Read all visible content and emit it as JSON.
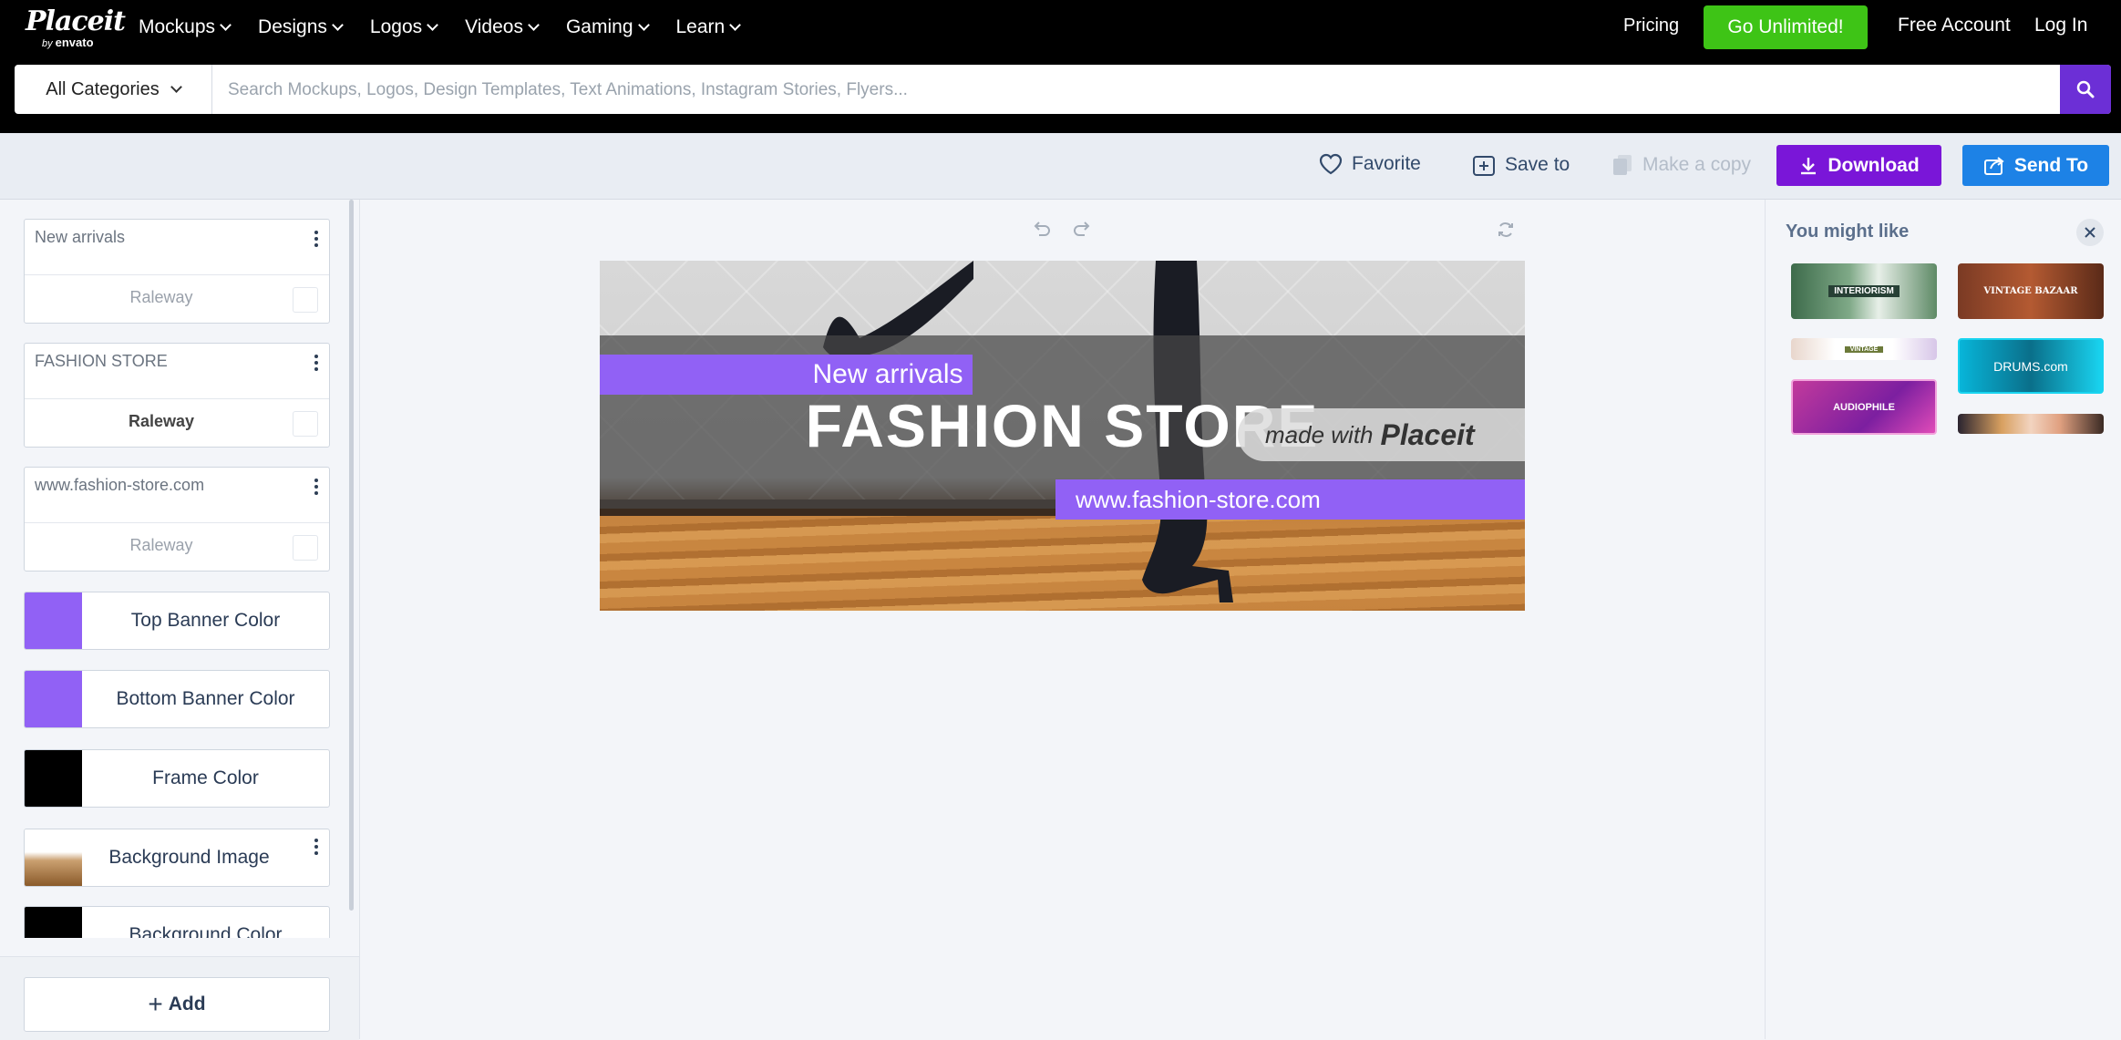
{
  "brand": {
    "logo_text": "Placeit",
    "logo_by": "by",
    "logo_sub": "envato"
  },
  "nav": {
    "items": [
      {
        "label": "Mockups"
      },
      {
        "label": "Designs"
      },
      {
        "label": "Logos"
      },
      {
        "label": "Videos"
      },
      {
        "label": "Gaming"
      },
      {
        "label": "Learn"
      }
    ],
    "pricing": "Pricing",
    "unlimited": "Go Unlimited!",
    "free_account": "Free Account",
    "login": "Log In"
  },
  "search": {
    "category": "All Categories",
    "placeholder": "Search Mockups, Logos, Design Templates, Text Animations, Instagram Stories, Flyers..."
  },
  "toolbar": {
    "favorite": "Favorite",
    "save_to": "Save to",
    "make_copy": "Make a copy",
    "download": "Download",
    "send_to": "Send To"
  },
  "left_panel": {
    "text_layers": [
      {
        "text": "New arrivals",
        "font": "Raleway"
      },
      {
        "text": "FASHION STORE",
        "font": "Raleway"
      },
      {
        "text": "www.fashion-store.com",
        "font": "Raleway"
      }
    ],
    "color_layers": [
      {
        "label": "Top Banner Color",
        "color": "#9161f5"
      },
      {
        "label": "Bottom Banner Color",
        "color": "#9161f5"
      },
      {
        "label": "Frame Color",
        "color": "#000000"
      }
    ],
    "background_image": "Background Image",
    "background_color": {
      "label": "Background Color",
      "color": "#000000"
    },
    "add": "Add"
  },
  "canvas": {
    "top_text": "New arrivals",
    "main_text": "FASHION STORE",
    "bottom_text": "www.fashion-store.com",
    "watermark_prefix": "made with",
    "watermark_brand": "Placeit",
    "accent_color": "#9161f5"
  },
  "right_panel": {
    "title": "You might like",
    "thumbnails": [
      {
        "label": "INTERIORISM"
      },
      {
        "label": "VINTAGE BAZAAR"
      },
      {
        "label": "VINTAGE"
      },
      {
        "label": "DRUMS.com"
      },
      {
        "label": "AUDIOPHILE"
      },
      {
        "label": ""
      }
    ]
  }
}
